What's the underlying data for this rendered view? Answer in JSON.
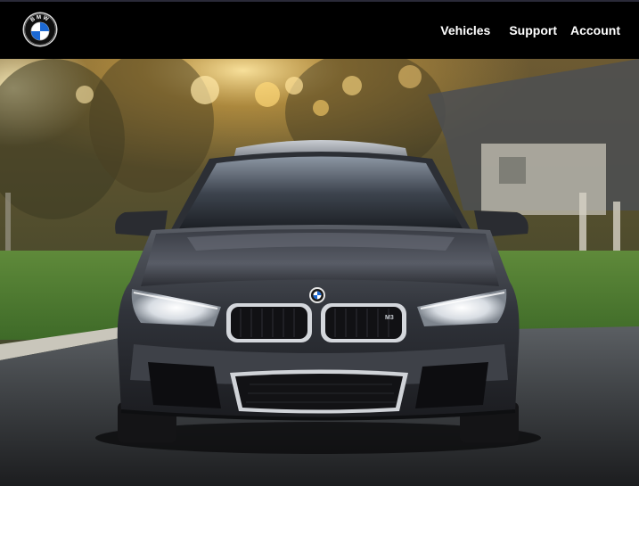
{
  "brand": {
    "logo_icon": "bmw-roundel-icon",
    "logo_letters": "BMW"
  },
  "nav": {
    "items": [
      {
        "label": "Vehicles"
      },
      {
        "label": "Support"
      },
      {
        "label": "Account"
      }
    ]
  },
  "hero": {
    "image_icon": "car-front-photo",
    "badge_text": "M3"
  },
  "colors": {
    "header_bg": "#000000",
    "nav_text": "#ffffff",
    "page_bg": "#ffffff",
    "roundel_blue": "#1c69d4"
  }
}
